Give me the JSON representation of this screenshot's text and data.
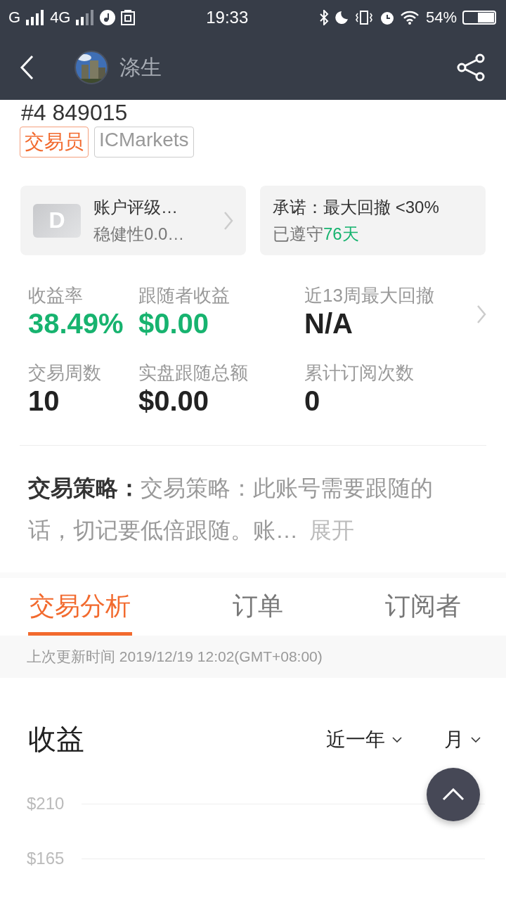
{
  "status_bar": {
    "carrier_1": "G",
    "carrier_2": "4G",
    "time": "19:33",
    "battery": "54%"
  },
  "header": {
    "title": "涤生"
  },
  "account_number": "#4 849015",
  "tags": [
    {
      "label": "交易员",
      "kind": "role"
    },
    {
      "label": "ICMarkets",
      "kind": "broker"
    }
  ],
  "rating_card": {
    "grade": "D",
    "title": "账户评级…",
    "subtitle": "稳健性0.0…"
  },
  "pledge_card": {
    "title": "承诺：最大回撤 <30%",
    "kept_prefix": "已遵守",
    "kept_days": "76天"
  },
  "stats": [
    {
      "label": "收益率",
      "value": "38.49%",
      "kind": "positive"
    },
    {
      "label": "跟随者收益",
      "value": "$0.00",
      "kind": "positive"
    },
    {
      "label": "近13周最大回撤",
      "value": "N/A",
      "kind": "neutral"
    },
    {
      "label": "交易周数",
      "value": "10",
      "kind": "neutral"
    },
    {
      "label": "实盘跟随总额",
      "value": "$0.00",
      "kind": "neutral"
    },
    {
      "label": "累计订阅次数",
      "value": "0",
      "kind": "neutral"
    }
  ],
  "strategy": {
    "label": "交易策略：",
    "text": "交易策略：此账号需要跟随的话，切记要低倍跟随。账…",
    "expand": "展开"
  },
  "tabs": [
    {
      "label": "交易分析",
      "selected": true
    },
    {
      "label": "订单",
      "selected": false
    },
    {
      "label": "订阅者",
      "selected": false
    }
  ],
  "update_time": "上次更新时间 2019/12/19 12:02(GMT+08:00)",
  "chart": {
    "title": "收益",
    "filters": [
      "近一年",
      "月"
    ],
    "y_ticks": [
      "$210",
      "$165"
    ]
  }
}
